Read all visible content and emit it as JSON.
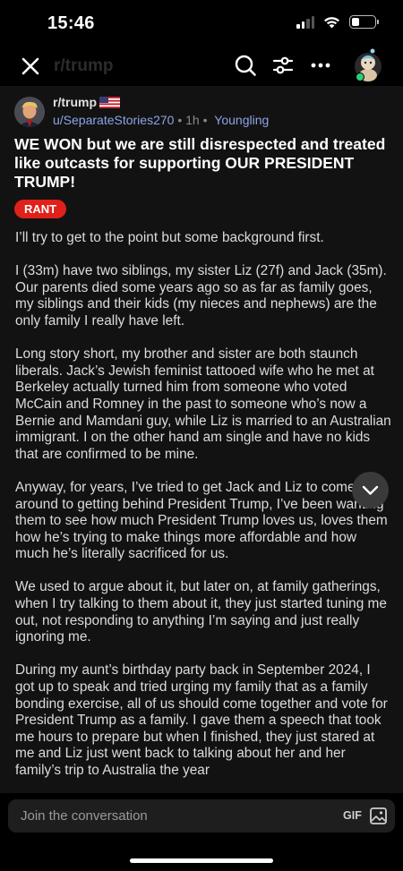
{
  "status_bar": {
    "time": "15:46",
    "battery_level": 0.35
  },
  "nav": {
    "title": "r/trump",
    "icons": [
      "close-icon",
      "search-icon",
      "filter-icon",
      "more-icon",
      "avatar"
    ]
  },
  "post": {
    "subreddit": "r/trump",
    "author": "u/SeparateStories270",
    "time": "1h",
    "separator": "•",
    "user_flair": "Youngling",
    "title": "WE WON but we are still disrespected and treated like outcasts for supporting OUR PRESIDENT TRUMP!",
    "flair": "RANT",
    "paragraphs": [
      "I’ll try to get to the point but some background first.",
      "I (33m) have two siblings, my sister Liz (27f) and Jack (35m). Our parents died some years ago so as far as family goes, my siblings and their kids (my nieces and nephews) are the only family I really have left.",
      "Long story short, my brother and sister are both staunch liberals. Jack’s Jewish feminist tattooed wife who he met at Berkeley actually turned him from someone who voted McCain and Romney in the past to someone who’s now a Bernie and Mamdani guy, while Liz is married to an Australian immigrant. I on the other hand am single and have no kids that are confirmed to be mine.",
      "Anyway, for years, I’ve tried to get Jack and Liz to come around to getting behind President Trump, I’ve been wanting them to see how much President Trump loves us, loves them how he’s trying to make things more affordable and how much he’s literally sacrificed for us.",
      "We used to argue about it, but later on, at family gatherings, when I try talking to them about it, they just started tuning me out, not responding to anything I’m saying and just really ignoring me.",
      "During my aunt’s birthday party back in September 2024, I got up to speak and tried urging my family that as a family bonding exercise, all of us should come together and vote for President Trump as a family. I gave them a speech that took me hours to prepare but when I finished, they just stared at me and Liz just went back to talking about her and her family’s trip to Australia the year"
    ]
  },
  "composer": {
    "placeholder": "Join the conversation",
    "gif_label": "GIF"
  },
  "colors": {
    "background": "#121212",
    "flair_red": "#e0201a",
    "link_blue": "#8da4e8",
    "online_green": "#2ecc71"
  }
}
